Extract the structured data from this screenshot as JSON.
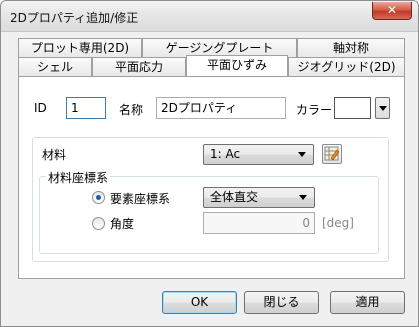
{
  "window": {
    "title": "2Dプロパティ追加/修正",
    "close_label": "✕"
  },
  "tabs": {
    "row_back": [
      "プロット専用(2D)",
      "ゲージングプレート",
      "軸対称"
    ],
    "row_front": [
      "シェル",
      "平面応力",
      "平面ひずみ",
      "ジオグリッド(2D)"
    ],
    "active": "平面ひずみ"
  },
  "form": {
    "id_label": "ID",
    "id_value": "1",
    "name_label": "名称",
    "name_value": "2Dプロパティ",
    "color_label": "カラー",
    "color_value": "#ffffff",
    "material_label": "材料",
    "material_value": "1: Ac",
    "material_coord": {
      "group_title": "材料座標系",
      "element_coord_label": "要素座標系",
      "element_coord_selected": true,
      "element_coord_value": "全体直交",
      "angle_label": "角度",
      "angle_selected": false,
      "angle_value": "0",
      "angle_unit": "[deg]"
    }
  },
  "buttons": {
    "ok": "OK",
    "close": "閉じる",
    "apply": "適用"
  }
}
